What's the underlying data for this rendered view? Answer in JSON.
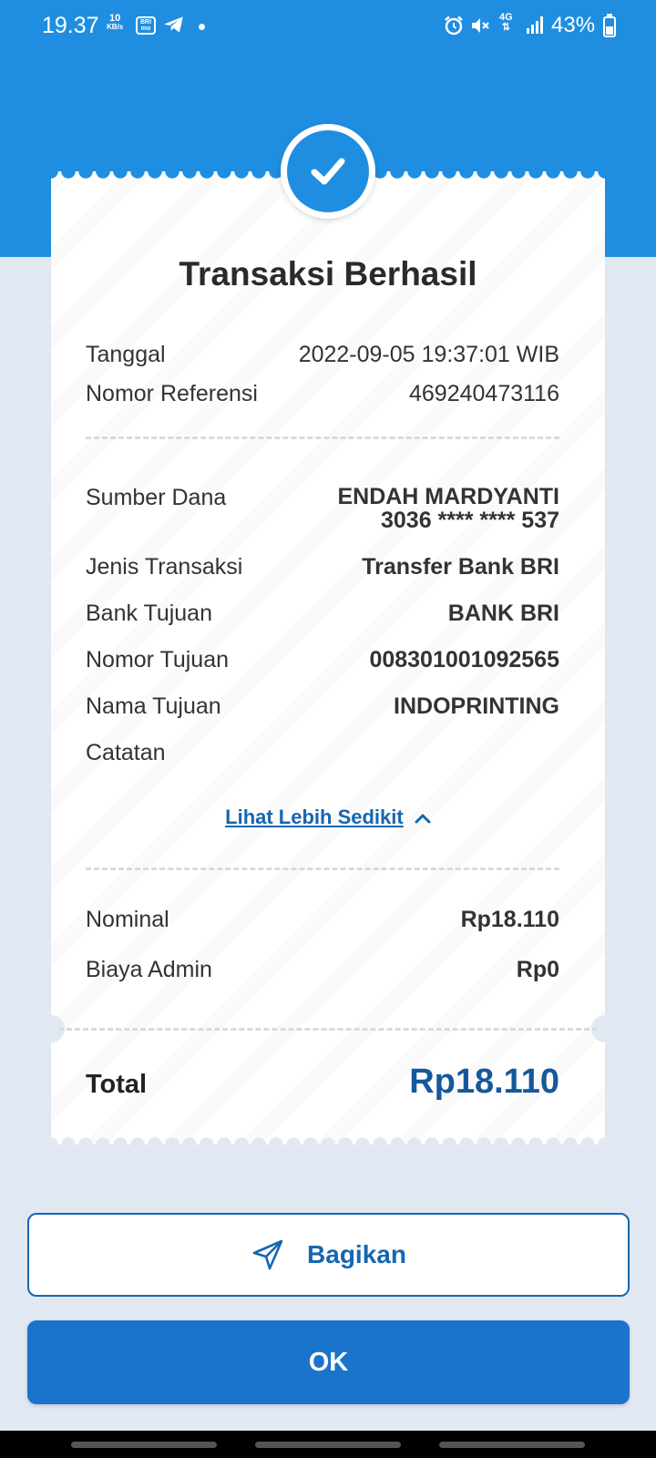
{
  "status_bar": {
    "time": "19.37",
    "net_speed": "10",
    "net_unit": "KB/s",
    "brimo": "BRI mo",
    "network_type": "4G",
    "battery": "43%"
  },
  "receipt": {
    "title": "Transaksi Berhasil",
    "date_label": "Tanggal",
    "date_value": "2022-09-05 19:37:01 WIB",
    "ref_label": "Nomor Referensi",
    "ref_value": "469240473116",
    "source_label": "Sumber Dana",
    "source_name": "ENDAH MARDYANTI",
    "source_account": "3036 **** **** 537",
    "type_label": "Jenis Transaksi",
    "type_value": "Transfer Bank BRI",
    "bank_label": "Bank Tujuan",
    "bank_value": "BANK BRI",
    "dest_no_label": "Nomor Tujuan",
    "dest_no_value": "008301001092565",
    "dest_name_label": "Nama Tujuan",
    "dest_name_value": "INDOPRINTING",
    "note_label": "Catatan",
    "note_value": "",
    "toggle_link": "Lihat Lebih Sedikit",
    "nominal_label": "Nominal",
    "nominal_value": "Rp18.110",
    "admin_label": "Biaya Admin",
    "admin_value": "Rp0",
    "total_label": "Total",
    "total_value": "Rp18.110"
  },
  "actions": {
    "share_label": "Bagikan",
    "ok_label": "OK"
  },
  "colors": {
    "brand_blue": "#1f8ee0",
    "button_blue": "#1a74cb",
    "total_blue": "#15589b"
  }
}
